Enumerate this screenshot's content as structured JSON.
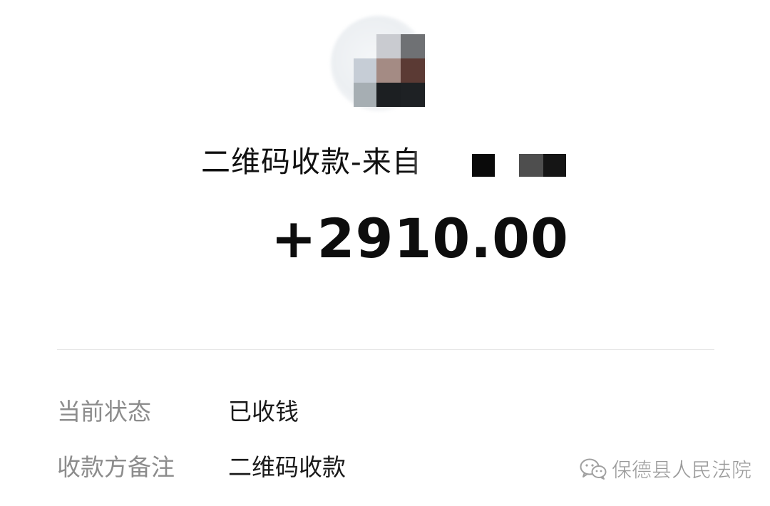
{
  "transaction": {
    "title": "二维码收款-来自",
    "amount": "+2910.00"
  },
  "details": [
    {
      "label": "当前状态",
      "value": "已收钱"
    },
    {
      "label": "收款方备注",
      "value": "二维码收款"
    }
  ],
  "watermark": {
    "icon": "wechat-icon",
    "text": "保德县人民法院"
  },
  "colors": {
    "label": "#8c8c8c",
    "value": "#1a1a1a",
    "amount": "#0d0d0d",
    "divider": "#e6e6e6"
  }
}
